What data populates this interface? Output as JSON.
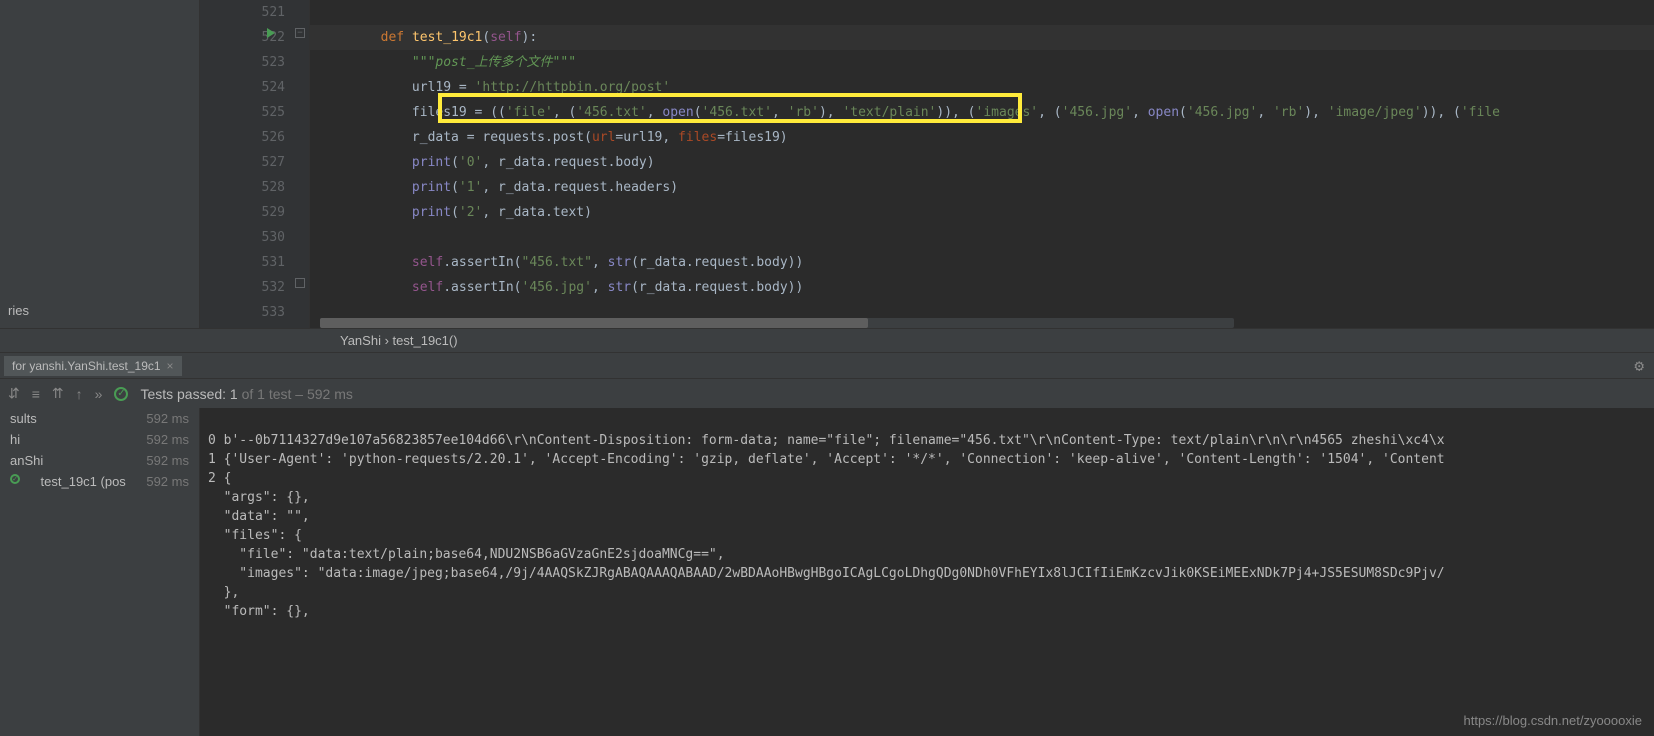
{
  "gutter": {
    "lines": [
      "521",
      "522",
      "523",
      "524",
      "525",
      "526",
      "527",
      "528",
      "529",
      "530",
      "531",
      "532",
      "533"
    ]
  },
  "code": {
    "l522_def": "def ",
    "l522_fn": "test_19c1",
    "l522_paren": "(",
    "l522_self": "self",
    "l522_end": "):",
    "l523": "\"\"\"post_上传多个文件\"\"\"",
    "l524_a": "url19 = ",
    "l524_b": "'http://httpbin.org/post'",
    "l525_a": "files19 = ((",
    "l525_s1": "'file'",
    "l525_c1": ", (",
    "l525_s2": "'456.txt'",
    "l525_c2": ", ",
    "l525_open": "open",
    "l525_p1": "(",
    "l525_s3": "'456.txt'",
    "l525_c3": ", ",
    "l525_s4": "'rb'",
    "l525_p2": "), ",
    "l525_s5": "'text/plain'",
    "l525_p3": ")), (",
    "l525_s6": "'images'",
    "l525_c4": ", (",
    "l525_s7": "'456.jpg'",
    "l525_c5": ", ",
    "l525_open2": "open",
    "l525_p4": "(",
    "l525_s8": "'456.jpg'",
    "l525_c6": ", ",
    "l525_s9": "'rb'",
    "l525_p5": "), ",
    "l525_s10": "'image/jpeg'",
    "l525_p6": ")), (",
    "l525_s11": "'file",
    "l526_a": "r_data = requests.post(",
    "l526_p1": "url",
    "l526_b": "=url19, ",
    "l526_p2": "files",
    "l526_c": "=files19)",
    "l527_a": "print",
    "l527_b": "(",
    "l527_c": "'0'",
    "l527_d": ", r_data.request.body)",
    "l528_a": "print",
    "l528_b": "(",
    "l528_c": "'1'",
    "l528_d": ", r_data.request.headers)",
    "l529_a": "print",
    "l529_b": "(",
    "l529_c": "'2'",
    "l529_d": ", r_data.text)",
    "l531_a": "self",
    "l531_b": ".assertIn(",
    "l531_c": "\"456.txt\"",
    "l531_d": ", ",
    "l531_e": "str",
    "l531_f": "(r_data.request.body))",
    "l532_a": "self",
    "l532_b": ".assertIn(",
    "l532_c": "'456.jpg'",
    "l532_d": ", ",
    "l532_e": "str",
    "l532_f": "(r_data.request.body))"
  },
  "breadcrumb": {
    "class": "YanShi",
    "sep": " › ",
    "method": "test_19c1()"
  },
  "run_tab": {
    "label": "for yanshi.YanShi.test_19c1"
  },
  "test_status": {
    "prefix": "Tests passed: 1",
    "suffix": " of 1 test – 592 ms"
  },
  "tree": {
    "r1_label": "sults",
    "r1_time": "592 ms",
    "r2_label": "hi",
    "r2_time": "592 ms",
    "r3_label": "anShi",
    "r3_time": "592 ms",
    "r4_label": "test_19c1 (pos",
    "r4_time": "592 ms"
  },
  "console": {
    "l1": "0 b'--0b7114327d9e107a56823857ee104d66\\r\\nContent-Disposition: form-data; name=\"file\"; filename=\"456.txt\"\\r\\nContent-Type: text/plain\\r\\n\\r\\n4565 zheshi\\xc4\\x",
    "l2": "1 {'User-Agent': 'python-requests/2.20.1', 'Accept-Encoding': 'gzip, deflate', 'Accept': '*/*', 'Connection': 'keep-alive', 'Content-Length': '1504', 'Content",
    "l3": "2 {",
    "l4": "  \"args\": {},",
    "l5": "  \"data\": \"\",",
    "l6": "  \"files\": {",
    "l7": "    \"file\": \"data:text/plain;base64,NDU2NSB6aGVzaGnE2sjdoaMNCg==\",",
    "l8": "    \"images\": \"data:image/jpeg;base64,/9j/4AAQSkZJRgABAQAAAQABAAD/2wBDAAoHBwgHBgoICAgLCgoLDhgQDg0NDh0VFhEYIx8lJCIfIiEmKzcvJik0KSEiMEExNDk7Pj4+JS5ESUM8SDc9Pjv/",
    "l9": "  },",
    "l10": "  \"form\": {},"
  },
  "project": {
    "item1": "ries"
  },
  "watermark": "https://blog.csdn.net/zyooooxie"
}
